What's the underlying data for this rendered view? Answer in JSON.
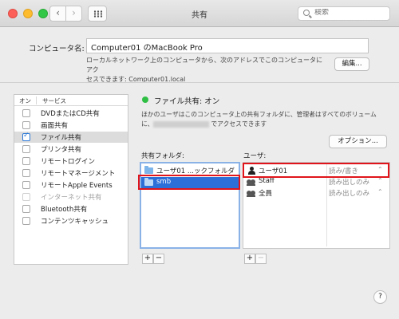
{
  "window": {
    "title": "共有",
    "search_placeholder": "検索",
    "nav_back": "‹",
    "nav_forward": "›"
  },
  "computer": {
    "label": "コンピュータ名:",
    "name": "Computer01 のMacBook Pro",
    "desc_line1": "ローカルネットワーク上のコンピュータから、次のアドレスでこのコンピュータにアク",
    "desc_line2": "セスできます: Computer01.local",
    "edit_button": "編集..."
  },
  "services": {
    "header_on": "オン",
    "header_service": "サービス",
    "items": [
      {
        "label": "DVDまたはCD共有",
        "checked": false,
        "selected": false,
        "dim": false
      },
      {
        "label": "画面共有",
        "checked": false,
        "selected": false,
        "dim": false
      },
      {
        "label": "ファイル共有",
        "checked": true,
        "selected": true,
        "dim": false
      },
      {
        "label": "プリンタ共有",
        "checked": false,
        "selected": false,
        "dim": false
      },
      {
        "label": "リモートログイン",
        "checked": false,
        "selected": false,
        "dim": false
      },
      {
        "label": "リモートマネージメント",
        "checked": false,
        "selected": false,
        "dim": false
      },
      {
        "label": "リモートApple Events",
        "checked": false,
        "selected": false,
        "dim": false
      },
      {
        "label": "インターネット共有",
        "checked": false,
        "selected": false,
        "dim": true
      },
      {
        "label": "Bluetooth共有",
        "checked": false,
        "selected": false,
        "dim": false
      },
      {
        "label": "コンテンツキャッシュ",
        "checked": false,
        "selected": false,
        "dim": false
      }
    ]
  },
  "file_sharing": {
    "status": "ファイル共有: オン",
    "status_color": "#2fbf45",
    "desc_line1": "ほかのユーザはこのコンピュータ上の共有フォルダに、管理者はすべてのボリューム",
    "desc_line2_suffix": "でアクセスできます",
    "desc_line2_prefix": "に、",
    "options_button": "オプション...",
    "folders_label": "共有フォルダ:",
    "users_label": "ユーザ:",
    "folders": [
      {
        "name": "ユーザ01 ...ックフォルダ",
        "selected": false
      },
      {
        "name": "smb",
        "selected": true
      }
    ],
    "users": [
      {
        "name": "ユーザ01",
        "permission": "読み/書き",
        "icon": "person-icon"
      },
      {
        "name": "Staff",
        "permission": "読み出しのみ",
        "icon": "group-icon"
      },
      {
        "name": "全員",
        "permission": "読み出しのみ",
        "icon": "group-icon"
      }
    ],
    "plus": "+",
    "minus": "−"
  },
  "help": "?",
  "highlight_color": "#e0141a"
}
